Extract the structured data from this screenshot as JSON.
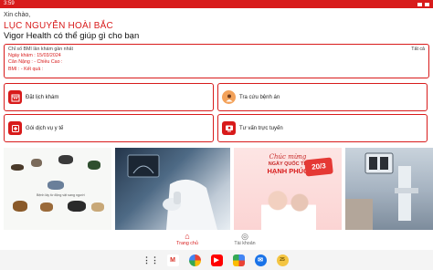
{
  "statusbar": {
    "time": "3:59"
  },
  "greeting": {
    "hello": "Xin chào,",
    "name": "LỤC NGUYỄN HOÀI BẮC",
    "tagline": "Vigor Health có thể giúp gì cho bạn"
  },
  "bmi_card": {
    "title": "Chỉ số BMI lần khám gần nhất",
    "see_all": "Tất cả",
    "exam_date": "Ngày khám : 15/03/2024",
    "weight_height": "Cân Nặng : - Chiều Cao :",
    "bmi_result": "BMI : - Kết quả :"
  },
  "features": [
    {
      "label": "Đặt lịch khám",
      "icon": "calendar-icon"
    },
    {
      "label": "Tra cứu bệnh án",
      "icon": "patient-record-icon"
    },
    {
      "label": "Gói dịch vụ y tế",
      "icon": "medical-package-icon"
    },
    {
      "label": "Tư vấn trực tuyến",
      "icon": "online-consult-icon"
    }
  ],
  "banners": {
    "b1_captions": [
      "Bệnh lây từ động vật sang người"
    ],
    "b3_title": "Chúc mừng",
    "b3_subtitle": "NGÀY QUỐC TẾ",
    "b3_headline": "HẠNH PHÚC",
    "b3_date": "20/3"
  },
  "bottom_nav": [
    {
      "label": "Trang chủ",
      "icon": "home-icon",
      "active": true
    },
    {
      "label": "Tài khoản",
      "icon": "account-icon",
      "active": false
    }
  ],
  "colors": {
    "brand": "#d81b1b"
  }
}
